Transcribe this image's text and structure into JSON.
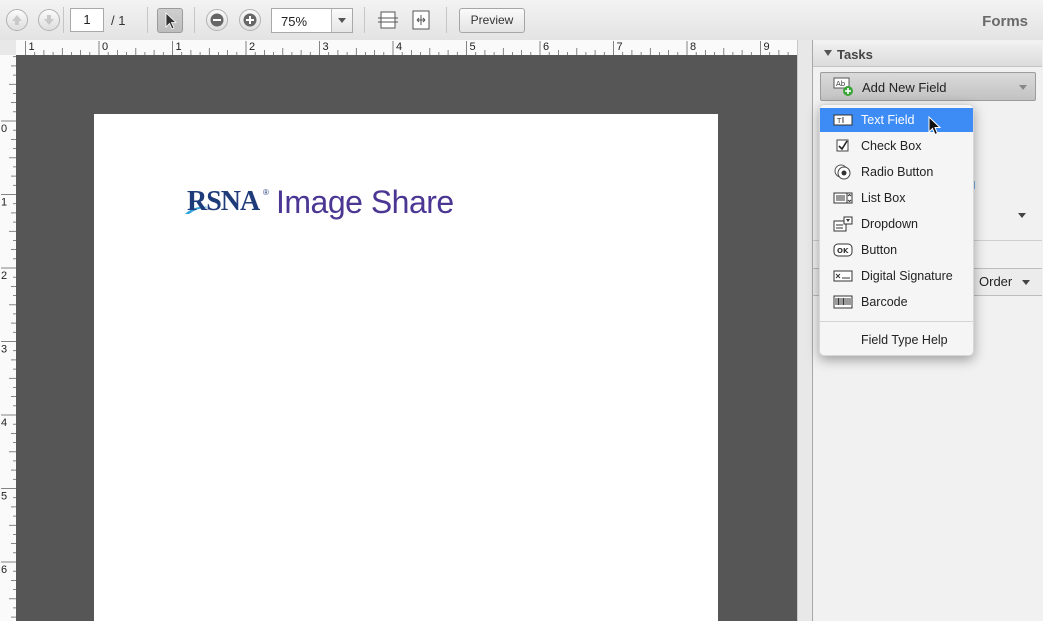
{
  "toolbar": {
    "page_current": "1",
    "page_total": "/ 1",
    "zoom_value": "75%",
    "preview_label": "Preview",
    "mode_title": "Forms"
  },
  "ruler": {
    "top_labels": [
      "1",
      "0",
      "1",
      "2",
      "3",
      "4",
      "5",
      "6",
      "7",
      "8",
      "9"
    ],
    "left_labels": [
      "0",
      "1",
      "2",
      "3",
      "4",
      "5",
      "6"
    ]
  },
  "document": {
    "logo_mark": "RSNA",
    "logo_text": "Image Share"
  },
  "panel": {
    "tasks_title": "Tasks",
    "add_field_label": "Add New Field",
    "order_label": "Order"
  },
  "menu": {
    "items": [
      {
        "label": "Text Field",
        "icon": "text-field-icon",
        "active": true
      },
      {
        "label": "Check Box",
        "icon": "check-box-icon"
      },
      {
        "label": "Radio Button",
        "icon": "radio-button-icon"
      },
      {
        "label": "List Box",
        "icon": "list-box-icon"
      },
      {
        "label": "Dropdown",
        "icon": "dropdown-icon"
      },
      {
        "label": "Button",
        "icon": "button-icon"
      },
      {
        "label": "Digital Signature",
        "icon": "digital-signature-icon"
      },
      {
        "label": "Barcode",
        "icon": "barcode-icon"
      }
    ],
    "help_label": "Field Type Help"
  },
  "colors": {
    "canvas_bg": "#565656",
    "menu_highlight": "#3d8bf5",
    "logo_blue": "#1f3c7a",
    "logo_purple": "#4b3693"
  }
}
